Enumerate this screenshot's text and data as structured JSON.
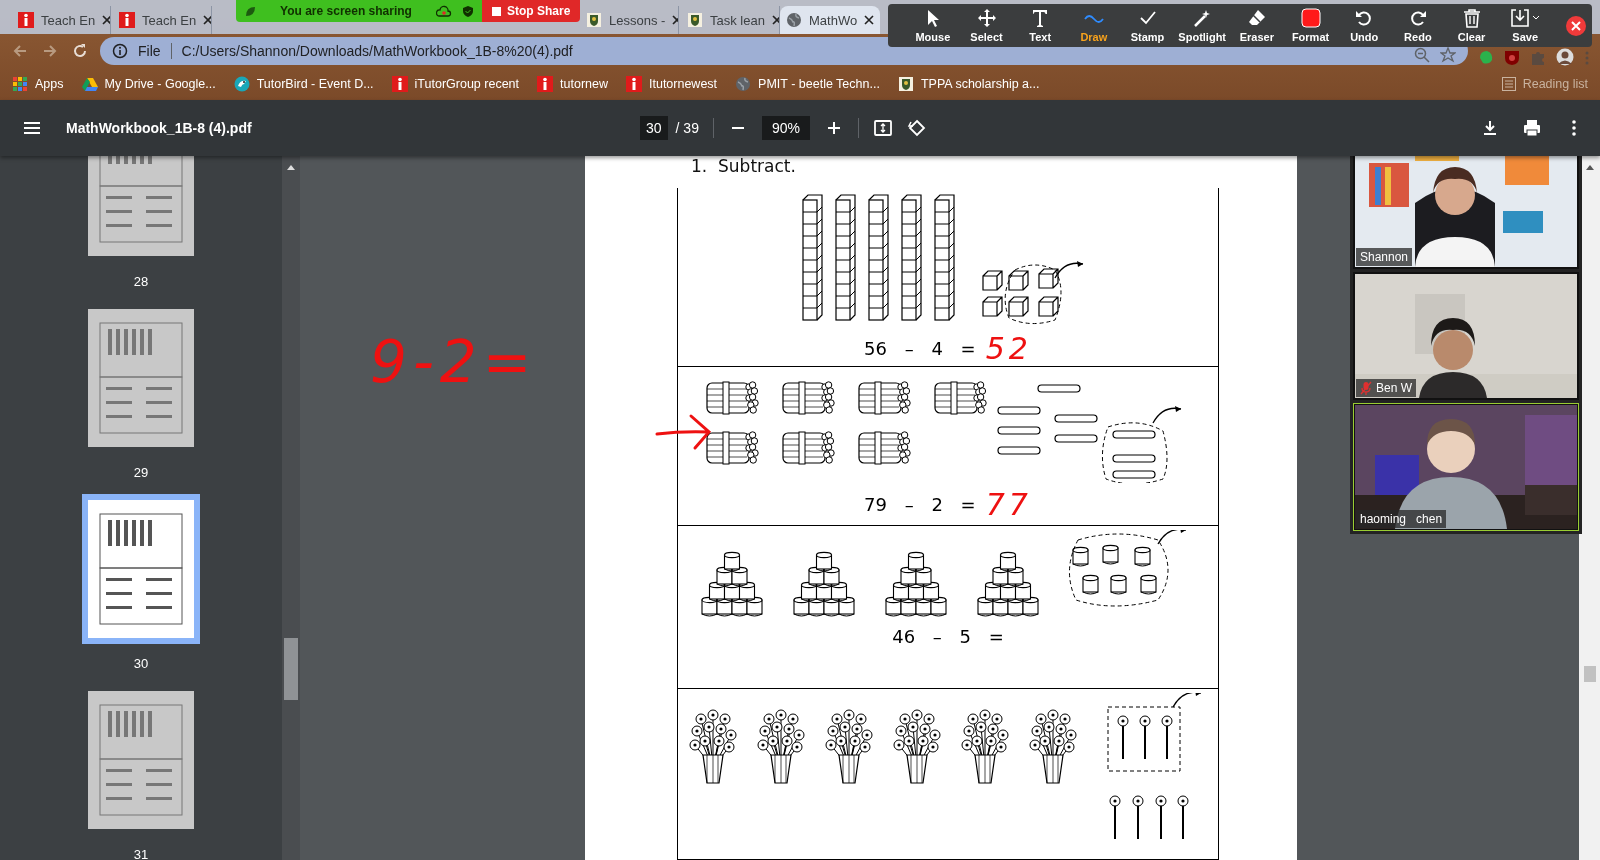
{
  "browser": {
    "tabs": [
      {
        "title": "Teach En",
        "selected": false
      },
      {
        "title": "Teach En",
        "selected": false
      },
      {
        "title": "Lessons -",
        "selected": false
      },
      {
        "title": "Task lean",
        "selected": false
      },
      {
        "title": "MathWo",
        "selected": true
      }
    ],
    "address": {
      "scheme": "File",
      "url": "C:/Users/Shannon/Downloads/MathWorkbook_1B-8%20(4).pdf"
    },
    "bookmarks": [
      {
        "label": "Apps"
      },
      {
        "label": "My Drive - Google..."
      },
      {
        "label": "TutorBird - Event D..."
      },
      {
        "label": "iTutorGroup recent"
      },
      {
        "label": "tutornew"
      },
      {
        "label": "Itutornewest"
      },
      {
        "label": "PMIT - beetle Techn..."
      },
      {
        "label": "TPPA scholarship a..."
      }
    ],
    "reading_list": "Reading list"
  },
  "share_banner": {
    "status": "You are screen sharing",
    "stop": "Stop Share"
  },
  "annotate_toolbar": {
    "tools": [
      {
        "label": "Mouse",
        "selected": false
      },
      {
        "label": "Select",
        "selected": false
      },
      {
        "label": "Text",
        "selected": false
      },
      {
        "label": "Draw",
        "selected": true
      },
      {
        "label": "Stamp",
        "selected": false
      },
      {
        "label": "Spotlight",
        "selected": false
      },
      {
        "label": "Eraser",
        "selected": false
      },
      {
        "label": "Format",
        "selected": false
      },
      {
        "label": "Undo",
        "selected": false
      },
      {
        "label": "Redo",
        "selected": false
      },
      {
        "label": "Clear",
        "selected": false
      },
      {
        "label": "Save",
        "selected": false
      }
    ]
  },
  "pdf": {
    "title": "MathWorkbook_1B-8 (4).pdf",
    "page": "30",
    "pages": "/ 39",
    "zoom": "90%",
    "thumbnails": [
      {
        "page": "28",
        "selected": false
      },
      {
        "page": "29",
        "selected": false
      },
      {
        "page": "30",
        "selected": true
      },
      {
        "page": "31",
        "selected": false
      }
    ],
    "worksheet": {
      "heading": "1.  Subtract.",
      "problems": [
        {
          "kind": "rods",
          "equation": "56 – 4 =",
          "answer": "52"
        },
        {
          "kind": "bundles",
          "equation": "79 – 2 =",
          "answer": "77"
        },
        {
          "kind": "stacks",
          "equation": "46 – 5 ="
        },
        {
          "kind": "flowers"
        }
      ]
    },
    "annotations": [
      {
        "text": "9-2="
      }
    ]
  },
  "participants": [
    {
      "name": "Shannon",
      "muted": false,
      "speaking": false
    },
    {
      "name": "Ben W",
      "muted": true,
      "speaking": false
    },
    {
      "name": "haoming   chen",
      "muted": false,
      "speaking": true
    }
  ]
}
